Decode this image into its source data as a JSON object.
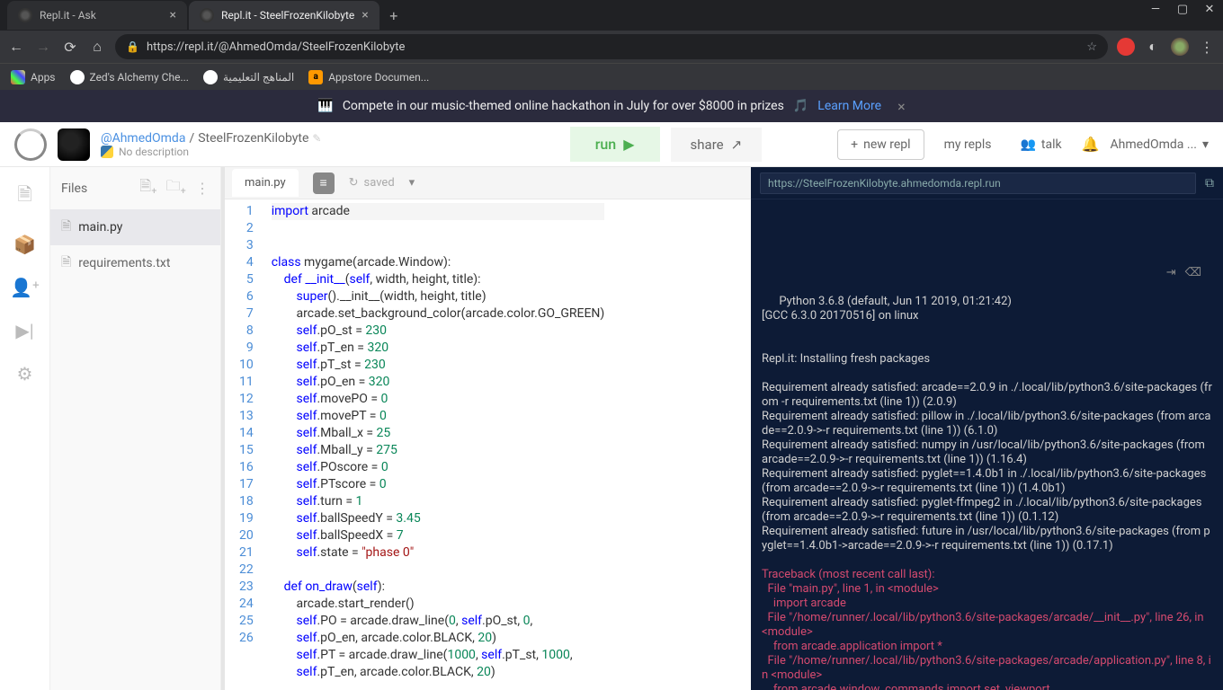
{
  "browser": {
    "tabs": [
      {
        "title": "Repl.it - Ask",
        "active": false
      },
      {
        "title": "Repl.it - SteelFrozenKilobyte",
        "active": true
      }
    ],
    "url": "https://repl.it/@AhmedOmda/SteelFrozenKilobyte",
    "bookmarks": {
      "apps": "Apps",
      "items": [
        "Zed's Alchemy Che...",
        "المناهج التعليمية",
        "Appstore Documen..."
      ]
    }
  },
  "banner": {
    "text": "Compete in our music-themed online hackathon in July for over $8000 in prizes",
    "learn_more": "Learn More"
  },
  "header": {
    "username": "@AhmedOmda",
    "separator": "/",
    "repl_name": "SteelFrozenKilobyte",
    "description": "No description",
    "run": "run",
    "share": "share",
    "new_repl": "new repl",
    "my_repls": "my repls",
    "talk": "talk",
    "user_menu": "AhmedOmda ..."
  },
  "files": {
    "header": "Files",
    "items": [
      {
        "name": "main.py",
        "active": true
      },
      {
        "name": "requirements.txt",
        "active": false
      }
    ]
  },
  "editor": {
    "tab": "main.py",
    "saved": "saved",
    "lines": [
      {
        "n": 1,
        "html": "<span class='kw'>import</span> arcade"
      },
      {
        "n": 2,
        "html": ""
      },
      {
        "n": 3,
        "html": ""
      },
      {
        "n": 4,
        "html": "<span class='kw'>class</span> <span class='cls'>mygame</span>(arcade.Window):"
      },
      {
        "n": 5,
        "html": "    <span class='kw'>def</span> <span class='fn'>__init__</span>(<span class='self'>self</span>, width, height, title):"
      },
      {
        "n": 6,
        "html": "        <span class='fn'>super</span>().__init__(width, height, title)"
      },
      {
        "n": 7,
        "html": "        arcade.set_background_color(arcade.color.GO_GREEN)"
      },
      {
        "n": 8,
        "html": "        <span class='self'>self</span>.pO_st = <span class='num'>230</span>"
      },
      {
        "n": 9,
        "html": "        <span class='self'>self</span>.pT_en = <span class='num'>320</span>"
      },
      {
        "n": 10,
        "html": "        <span class='self'>self</span>.pT_st = <span class='num'>230</span>"
      },
      {
        "n": 11,
        "html": "        <span class='self'>self</span>.pO_en = <span class='num'>320</span>"
      },
      {
        "n": 12,
        "html": "        <span class='self'>self</span>.movePO = <span class='num'>0</span>"
      },
      {
        "n": 13,
        "html": "        <span class='self'>self</span>.movePT = <span class='num'>0</span>"
      },
      {
        "n": 14,
        "html": "        <span class='self'>self</span>.Mball_x = <span class='num'>25</span>"
      },
      {
        "n": 15,
        "html": "        <span class='self'>self</span>.Mball_y = <span class='num'>275</span>"
      },
      {
        "n": 16,
        "html": "        <span class='self'>self</span>.POscore = <span class='num'>0</span>"
      },
      {
        "n": 17,
        "html": "        <span class='self'>self</span>.PTscore = <span class='num'>0</span>"
      },
      {
        "n": 18,
        "html": "        <span class='self'>self</span>.turn = <span class='num'>1</span>"
      },
      {
        "n": 19,
        "html": "        <span class='self'>self</span>.ballSpeedY = <span class='num'>3.45</span>"
      },
      {
        "n": 20,
        "html": "        <span class='self'>self</span>.ballSpeedX = <span class='num'>7</span>"
      },
      {
        "n": 21,
        "html": "        <span class='self'>self</span>.state = <span class='str'>\"phase 0\"</span>"
      },
      {
        "n": 22,
        "html": ""
      },
      {
        "n": 23,
        "html": "    <span class='kw'>def</span> <span class='fn'>on_draw</span>(<span class='self'>self</span>):"
      },
      {
        "n": 24,
        "html": "        arcade.start_render()"
      },
      {
        "n": 25,
        "html": "        <span class='self'>self</span>.PO = arcade.draw_line(<span class='num'>0</span>, <span class='self'>self</span>.pO_st, <span class='num'>0</span>,\n        <span class='self'>self</span>.pO_en, arcade.color.BLACK, <span class='num'>20</span>)"
      },
      {
        "n": 26,
        "html": "        <span class='self'>self</span>.PT = arcade.draw_line(<span class='num'>1000</span>, <span class='self'>self</span>.pT_st, <span class='num'>1000</span>,\n        <span class='self'>self</span>.pT_en, arcade.color.BLACK, <span class='num'>20</span>)"
      }
    ]
  },
  "console": {
    "url": "https://SteelFrozenKilobyte.ahmedomda.repl.run",
    "output": "Python 3.6.8 (default, Jun 11 2019, 01:21:42)\n[GCC 6.3.0 20170516] on linux\n\n\nRepl.it: Installing fresh packages\n\nRequirement already satisfied: arcade==2.0.9 in ./.local/lib/python3.6/site-packages (from -r requirements.txt (line 1)) (2.0.9)\nRequirement already satisfied: pillow in ./.local/lib/python3.6/site-packages (from arcade==2.0.9->-r requirements.txt (line 1)) (6.1.0)\nRequirement already satisfied: numpy in /usr/local/lib/python3.6/site-packages (from arcade==2.0.9->-r requirements.txt (line 1)) (1.16.4)\nRequirement already satisfied: pyglet==1.4.0b1 in ./.local/lib/python3.6/site-packages (from arcade==2.0.9->-r requirements.txt (line 1)) (1.4.0b1)\nRequirement already satisfied: pyglet-ffmpeg2 in ./.local/lib/python3.6/site-packages (from arcade==2.0.9->-r requirements.txt (line 1)) (0.1.12)\nRequirement already satisfied: future in /usr/local/lib/python3.6/site-packages (from pyglet==1.4.0b1->arcade==2.0.9->-r requirements.txt (line 1)) (0.17.1)",
    "error": "Traceback (most recent call last):\n  File \"main.py\", line 1, in <module>\n    import arcade\n  File \"/home/runner/.local/lib/python3.6/site-packages/arcade/__init__.py\", line 26, in <module>\n    from arcade.application import *\n  File \"/home/runner/.local/lib/python3.6/site-packages/arcade/application.py\", line 8, in <module>\n    from arcade.window_commands import set_viewport"
  }
}
